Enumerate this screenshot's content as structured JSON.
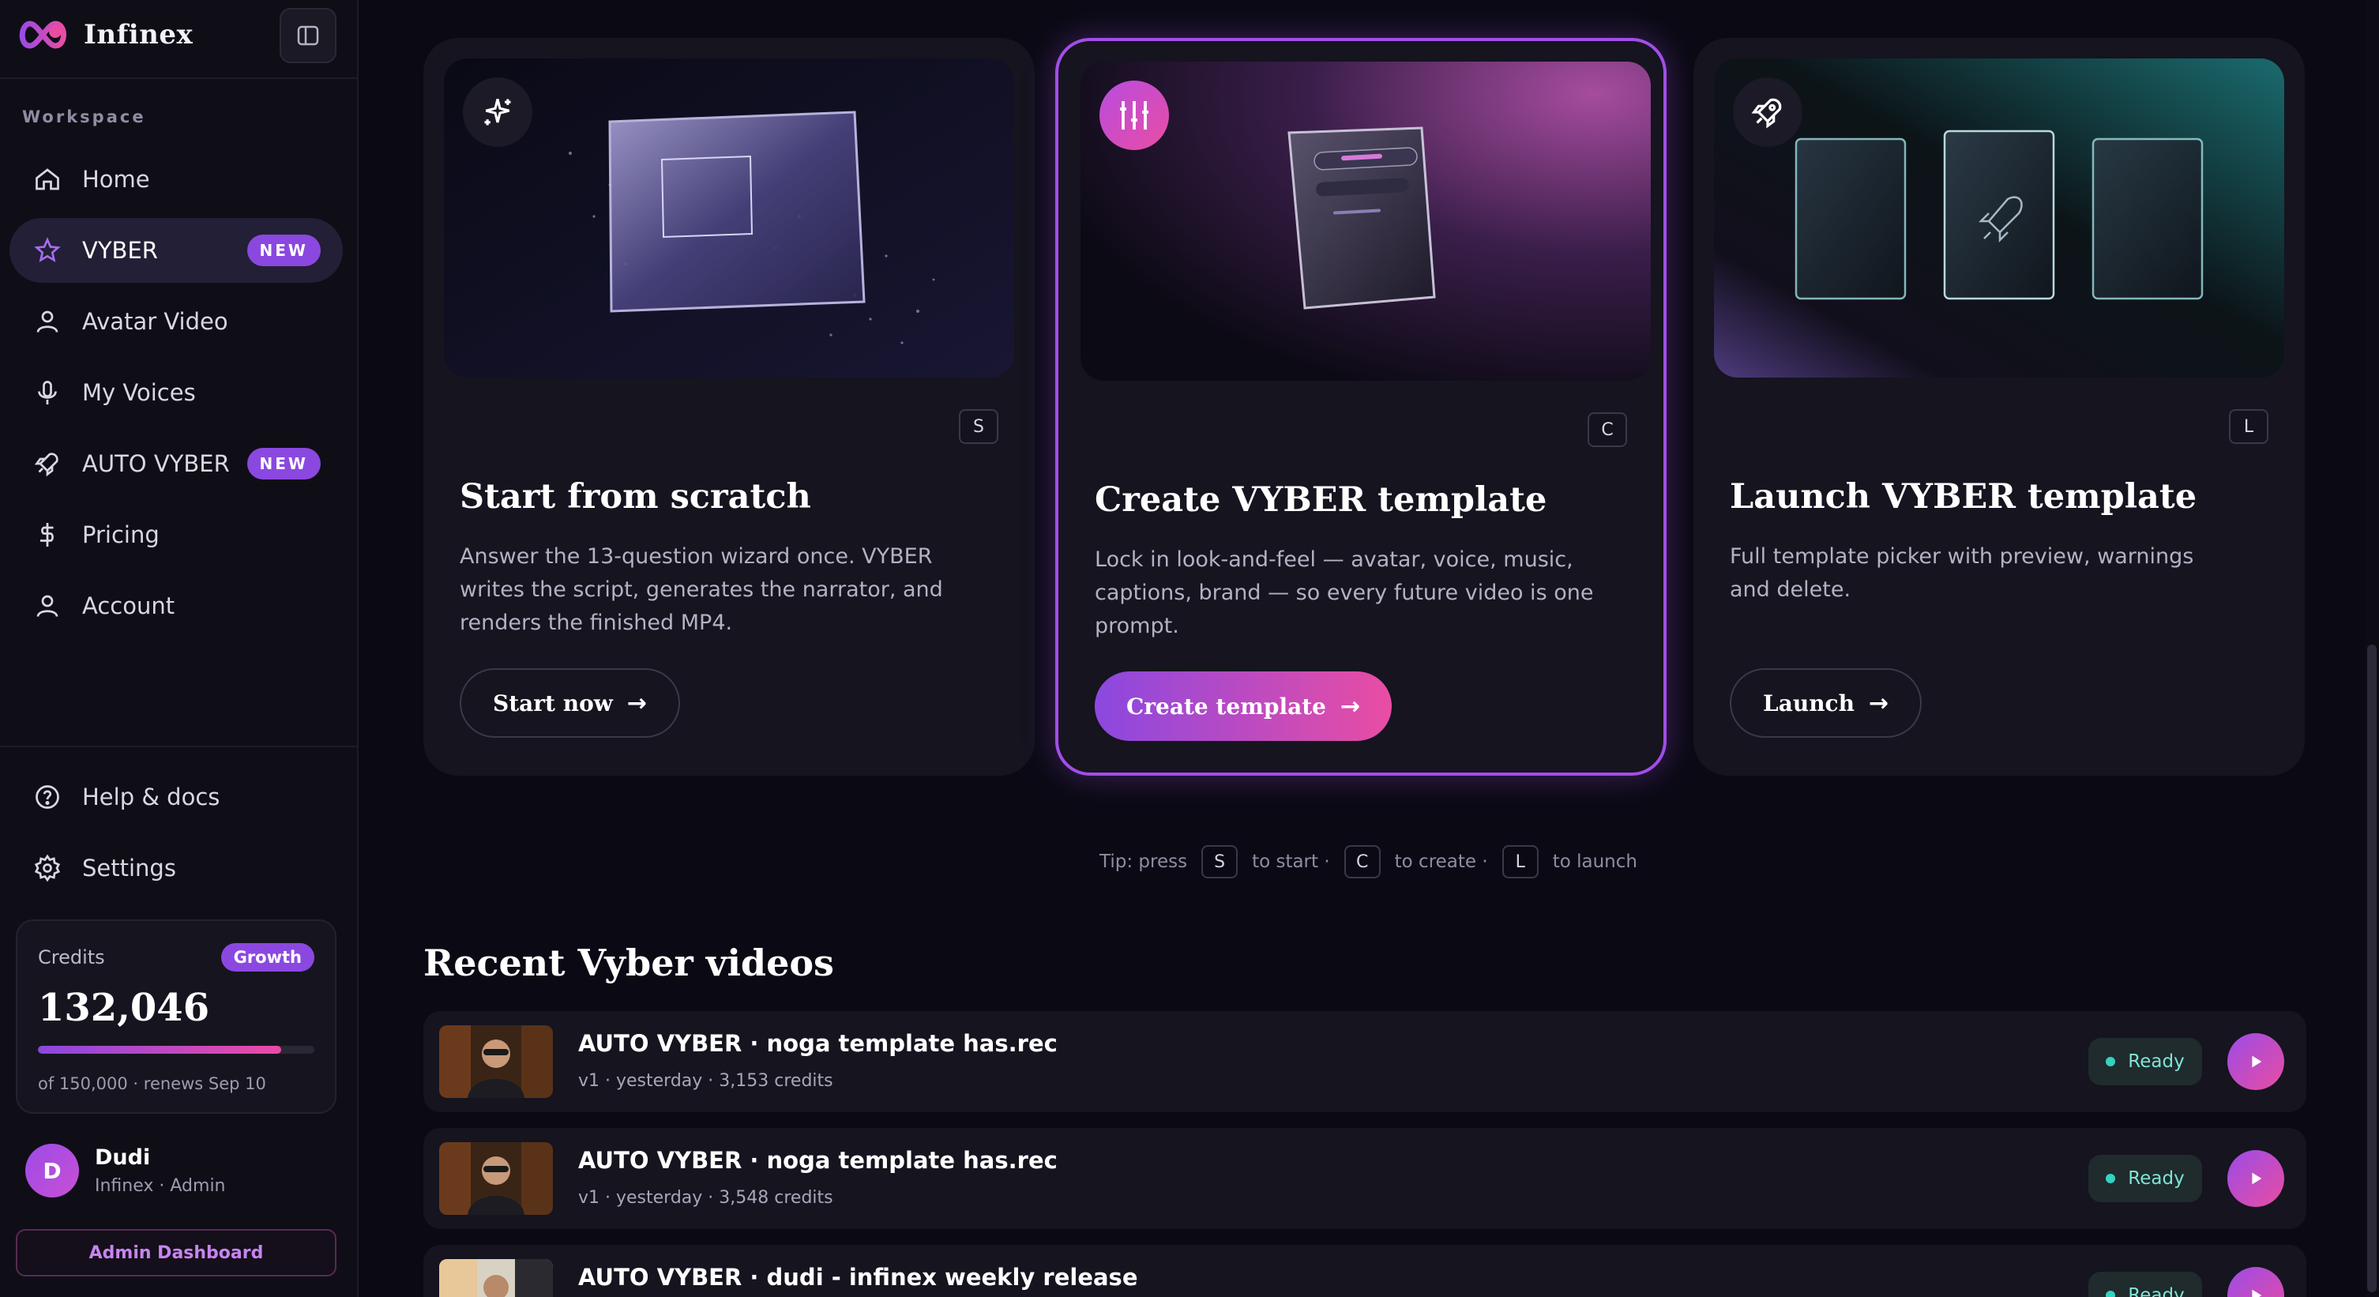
{
  "app": {
    "name": "Infinex"
  },
  "sidebar": {
    "workspace_label": "Workspace",
    "items": [
      {
        "label": "Home",
        "icon": "home-icon"
      },
      {
        "label": "VYBER",
        "icon": "star-icon",
        "badge": "NEW",
        "active": true
      },
      {
        "label": "Avatar Video",
        "icon": "user-icon"
      },
      {
        "label": "My Voices",
        "icon": "mic-icon"
      },
      {
        "label": "AUTO VYBER",
        "icon": "rocket-icon",
        "badge": "NEW"
      },
      {
        "label": "Pricing",
        "icon": "dollar-icon"
      },
      {
        "label": "Account",
        "icon": "user-icon"
      }
    ],
    "bottom_items": [
      {
        "label": "Help & docs",
        "icon": "help-icon"
      },
      {
        "label": "Settings",
        "icon": "gear-icon"
      }
    ],
    "credits": {
      "label": "Credits",
      "plan": "Growth",
      "value": "132,046",
      "fraction_used": 0.88,
      "sub": "of 150,000 · renews Sep 10"
    },
    "user": {
      "initial": "D",
      "name": "Dudi",
      "role": "Infinex · Admin"
    },
    "admin_button": "Admin Dashboard"
  },
  "cards": [
    {
      "key": "S",
      "title": "Start from scratch",
      "description": "Answer the 13-question wizard once. VYBER writes the script, generates the narrator, and renders the finished MP4.",
      "button": "Start now",
      "icon": "sparkle-icon"
    },
    {
      "key": "C",
      "title": "Create VYBER template",
      "description": "Lock in look-and-feel — avatar, voice, music, captions, brand — so every future video is one prompt.",
      "button": "Create template",
      "icon": "sliders-icon"
    },
    {
      "key": "L",
      "title": "Launch VYBER template",
      "description": "Full template picker with preview, warnings and delete.",
      "button": "Launch",
      "icon": "rocket-icon"
    }
  ],
  "tip": {
    "prefix": "Tip: press",
    "k1": "S",
    "t1": "to start ·",
    "k2": "C",
    "t2": "to create ·",
    "k3": "L",
    "t3": "to launch"
  },
  "recent": {
    "title": "Recent Vyber videos",
    "videos": [
      {
        "title": "AUTO VYBER · noga template has.rec",
        "meta": "v1 · yesterday · 3,153 credits",
        "status": "Ready"
      },
      {
        "title": "AUTO VYBER · noga template has.rec",
        "meta": "v1 · yesterday · 3,548 credits",
        "status": "Ready"
      },
      {
        "title": "AUTO VYBER · dudi - infinex weekly release",
        "meta": "",
        "status": "Ready"
      }
    ]
  },
  "colors": {
    "accent": "#8b48e0",
    "accent2": "#e94da3",
    "ready": "#34d3bf"
  }
}
